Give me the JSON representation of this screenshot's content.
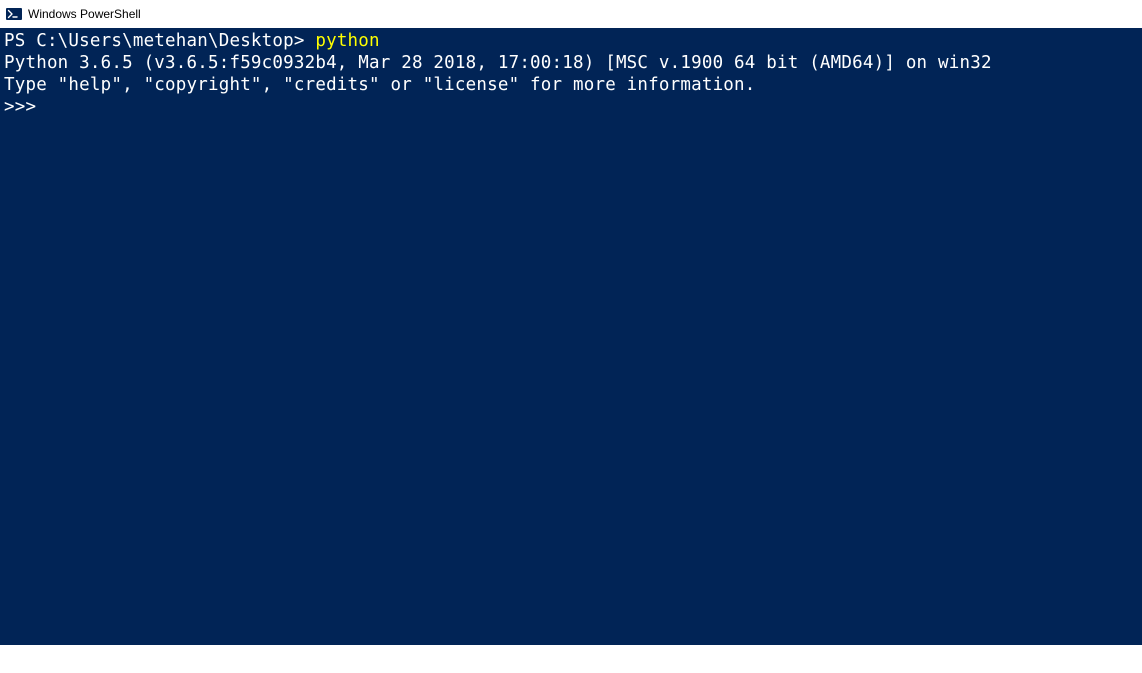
{
  "window": {
    "title": "Windows PowerShell"
  },
  "terminal": {
    "prompt_path": "PS C:\\Users\\metehan\\Desktop> ",
    "command": "python",
    "output_line1": "Python 3.6.5 (v3.6.5:f59c0932b4, Mar 28 2018, 17:00:18) [MSC v.1900 64 bit (AMD64)] on win32",
    "output_line2": "Type \"help\", \"copyright\", \"credits\" or \"license\" for more information.",
    "repl_prompt": ">>>"
  }
}
